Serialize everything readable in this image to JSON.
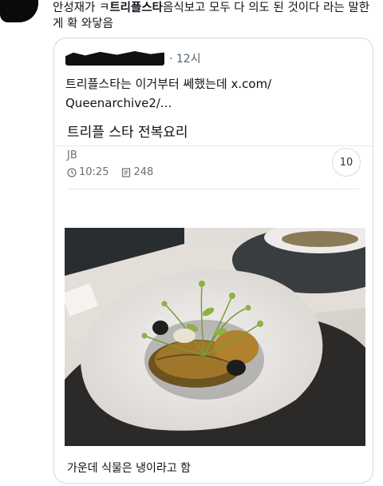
{
  "tweet": {
    "text_before": "안성재가 ㅋ",
    "text_bold": "트리플스타",
    "text_after": "음식보고 모두 다 의도 된 것이다 라는 말한게 확 와닿음"
  },
  "quote": {
    "time": "· 12시",
    "body": "트리플스타는 이거부터 쎄했는데 x.com/ Queenarchive2/..."
  },
  "post": {
    "title": "트리플 스타 전복요리",
    "author": "JB",
    "time": "10:25",
    "views": "248",
    "comments": "10",
    "caption": "가운데 식물은 냉이라고 함"
  },
  "icons": {
    "time": "clock-icon",
    "views": "document-icon"
  }
}
